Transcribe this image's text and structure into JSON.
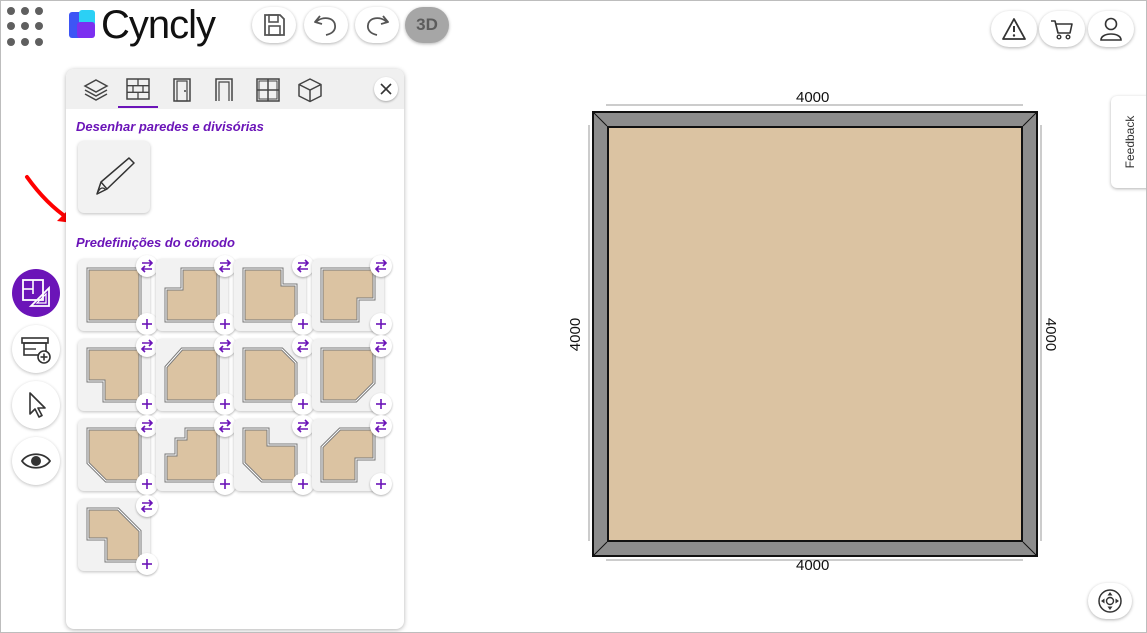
{
  "app": {
    "name": "Cyncly"
  },
  "toolbar": {
    "three_d_label": "3D"
  },
  "panel": {
    "section_draw_title": "Desenhar paredes e divisórias",
    "section_presets_title": "Predefinições do cômodo",
    "tabs": [
      "layers",
      "walls",
      "doors",
      "openings",
      "windows",
      "objects"
    ],
    "preset_count": 13
  },
  "canvas": {
    "dimension_top": "4000",
    "dimension_bottom": "4000",
    "dimension_left": "4000",
    "dimension_right": "4000"
  },
  "feedback": {
    "label": "Feedback"
  },
  "colors": {
    "accent": "#6b14b8",
    "floor": "#dbc3a2",
    "wall": "#8c8c8c",
    "annotation": "#ff0000"
  }
}
